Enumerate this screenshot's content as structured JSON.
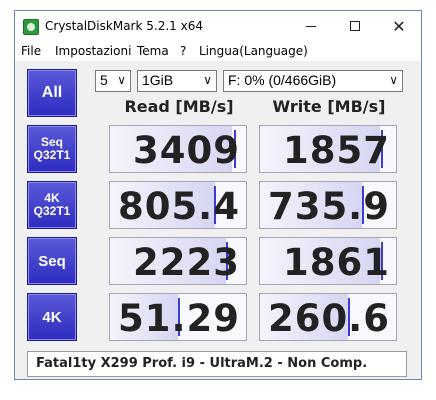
{
  "window": {
    "title": "CrystalDiskMark 5.2.1 x64",
    "controls": {
      "minimize": "",
      "maximize": "",
      "close": "✕"
    }
  },
  "menu": [
    "File",
    "Impostazioni",
    "Tema",
    "?",
    "Lingua(Language)"
  ],
  "toolbar": {
    "all_label": "All",
    "count": "5",
    "size": "1GiB",
    "drive": "F: 0% (0/466GiB)",
    "dropdown_arrow": "∨"
  },
  "columns": {
    "read": "Read [MB/s]",
    "write": "Write [MB/s]"
  },
  "rows": [
    {
      "label_line1": "Seq",
      "label_line2": "Q32T1",
      "read": "3409",
      "write": "1857"
    },
    {
      "label_line1": "4K",
      "label_line2": "Q32T1",
      "read": "805.4",
      "write": "735.9"
    },
    {
      "label_line1": "Seq",
      "label_line2": "",
      "read": "2223",
      "write": "1861"
    },
    {
      "label_line1": "4K",
      "label_line2": "",
      "read": "51.29",
      "write": "260.6"
    }
  ],
  "comment": "Fatal1ty X299 Prof. i9 - UltraM.2 - Non Comp.",
  "colors": {
    "button": "#3a39c8",
    "accent": "#3b3bd0",
    "border": "#6b87b0"
  }
}
